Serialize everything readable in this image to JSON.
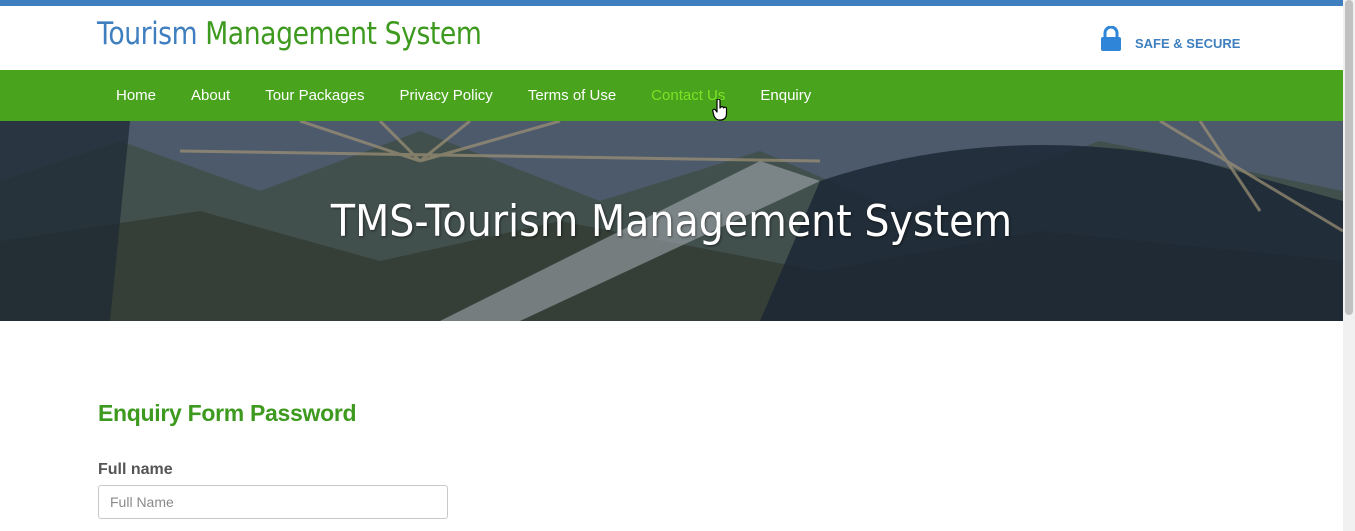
{
  "header": {
    "logo_part1": "Tourism",
    "logo_part2": "Management System",
    "secure_text": "SAFE & SECURE"
  },
  "nav": {
    "items": [
      "Home",
      "About",
      "Tour Packages",
      "Privacy Policy",
      "Terms of Use",
      "Contact Us",
      "Enquiry"
    ],
    "active": "Contact Us"
  },
  "hero": {
    "title": "TMS-Tourism Management System"
  },
  "form": {
    "heading": "Enquiry Form Password",
    "fullname_label": "Full name",
    "fullname_placeholder": "Full Name",
    "fullname_value": ""
  },
  "colors": {
    "brand_blue": "#3f7fbf",
    "brand_green": "#3d9a1f",
    "nav_bg": "#49a31d",
    "nav_active": "#7be324"
  },
  "icons": {
    "secure": "lock-icon",
    "cursor": "hand-pointer-icon"
  }
}
